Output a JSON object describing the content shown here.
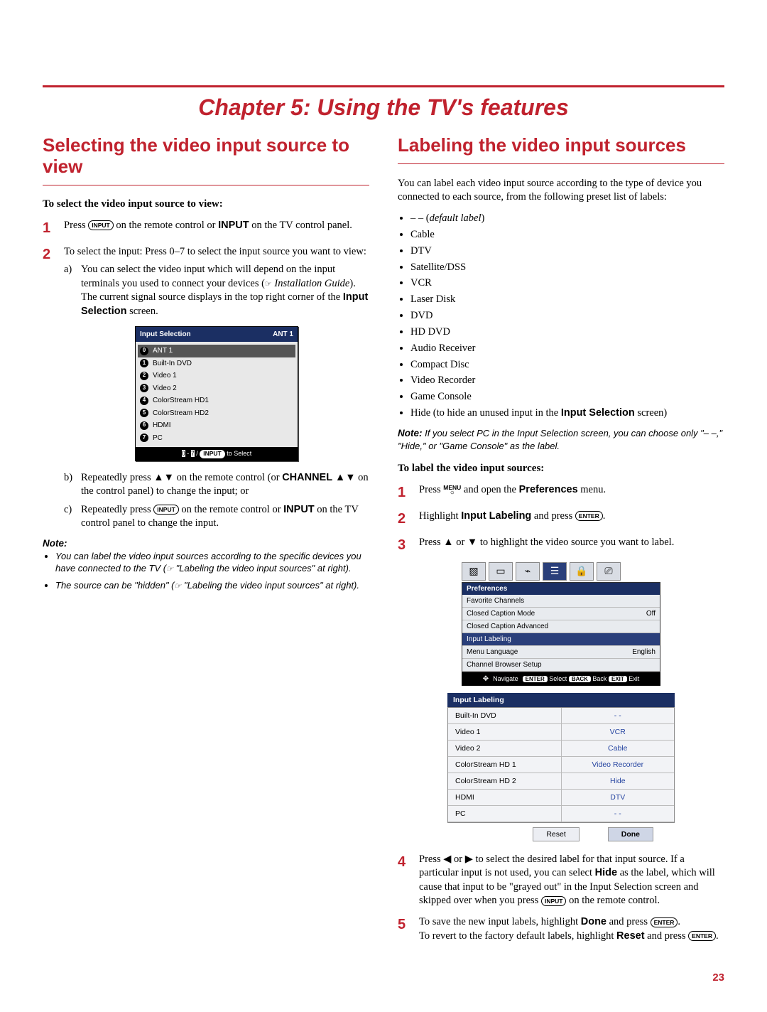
{
  "chapter_title": "Chapter 5: Using the TV's features",
  "page_number": "23",
  "left": {
    "heading": "Selecting the video input source to view",
    "proc_title": "To select the video input source to view:",
    "step1": {
      "prefix": "Press ",
      "key": "INPUT",
      "mid": " on the remote control or ",
      "bold": "INPUT",
      "suffix": " on the TV control panel."
    },
    "step2": {
      "text": "To select the input: Press 0–7 to select the input source you want to view:",
      "a_pre": "You can select the video input which will depend on the input terminals you used to connect your devices (",
      "a_hand": "☞",
      "a_ital": " Installation Guide",
      "a_post": ").",
      "a_line2_pre": "The current signal source displays in the top right corner of the ",
      "a_line2_bold": "Input Selection",
      "a_line2_post": " screen.",
      "b_pre": "Repeatedly press ▲▼ on the remote control (or ",
      "b_bold": "CHANNEL ▲▼",
      "b_post": " on the control panel) to change the input; or",
      "c_pre": "Repeatedly press ",
      "c_key": "INPUT",
      "c_mid": " on the remote control or ",
      "c_bold": "INPUT",
      "c_post": " on the TV control panel to change the input."
    },
    "osd": {
      "title": "Input Selection",
      "badge": "ANT 1",
      "items": [
        {
          "n": "0",
          "label": "ANT 1",
          "hl": true
        },
        {
          "n": "1",
          "label": "Built-In DVD"
        },
        {
          "n": "2",
          "label": "Video 1"
        },
        {
          "n": "3",
          "label": "Video 2"
        },
        {
          "n": "4",
          "label": "ColorStream HD1"
        },
        {
          "n": "5",
          "label": "ColorStream HD2"
        },
        {
          "n": "6",
          "label": "HDMI"
        },
        {
          "n": "7",
          "label": "PC"
        }
      ],
      "footer_a": "0",
      "footer_b": "7",
      "footer_sep": " - ",
      "footer_slash": " / ",
      "footer_pill": "INPUT",
      "footer_tail": " to Select"
    },
    "note_title": "Note:",
    "note_items": [
      {
        "pre": "You can label the video input sources according to the specific devices you have connected to the TV (",
        "hand": "☞",
        "ital": " \"Labeling the video input sources\" at right",
        "post": ")."
      },
      {
        "pre": "The source can be \"hidden\" (",
        "hand": "☞",
        "ital": " \"Labeling the video input sources\" at right",
        "post": ")."
      }
    ]
  },
  "right": {
    "heading": "Labeling the video input sources",
    "intro_pre": "You can label each video input source according to the type of device you connected to each source, from the following preset list of labels:",
    "labels": [
      {
        "text": "– – (",
        "ital": "default label",
        "post": ")"
      },
      {
        "text": "Cable"
      },
      {
        "text": "DTV"
      },
      {
        "text": "Satellite/DSS"
      },
      {
        "text": "VCR"
      },
      {
        "text": "Laser Disk"
      },
      {
        "text": "DVD"
      },
      {
        "text": "HD DVD"
      },
      {
        "text": "Audio Receiver"
      },
      {
        "text": "Compact Disc"
      },
      {
        "text": "Video Recorder"
      },
      {
        "text": "Game Console"
      },
      {
        "pretext": "Hide (to hide an unused input in the ",
        "bold": "Input Selection",
        "post": " screen)"
      }
    ],
    "note_title": "Note:",
    "note_body": " If you select PC in the Input Selection screen, you can choose only \"– –,\" \"Hide,\" or \"Game Console\" as the label.",
    "proc_title": "To label the video input sources:",
    "step1": {
      "pre": "Press ",
      "menu": "MENU",
      "mid": " and open the ",
      "bold": "Preferences",
      "post": " menu."
    },
    "step2": {
      "pre": "Highlight ",
      "bold": "Input Labeling",
      "mid": " and press ",
      "key": "ENTER",
      "post": "."
    },
    "step3": {
      "text": "Press ▲ or ▼ to highlight the video source you want to label."
    },
    "pref": {
      "title": "Preferences",
      "rows": [
        {
          "l": "Favorite Channels",
          "r": ""
        },
        {
          "l": "Closed Caption Mode",
          "r": "Off"
        },
        {
          "l": "Closed Caption Advanced",
          "r": ""
        },
        {
          "l": "Input Labeling",
          "r": "",
          "hl": true
        },
        {
          "l": "Menu Language",
          "r": "English"
        },
        {
          "l": "Channel Browser Setup",
          "r": ""
        }
      ],
      "foot_nav": "Navigate",
      "foot_keys": [
        {
          "k": "ENTER",
          "t": "Select"
        },
        {
          "k": "BACK",
          "t": "Back"
        },
        {
          "k": "EXIT",
          "t": "Exit"
        }
      ]
    },
    "il": {
      "title": "Input Labeling",
      "rows": [
        {
          "l": "Built-In DVD",
          "r": "- -"
        },
        {
          "l": "Video 1",
          "r": "VCR"
        },
        {
          "l": "Video 2",
          "r": "Cable"
        },
        {
          "l": "ColorStream HD 1",
          "r": "Video Recorder"
        },
        {
          "l": "ColorStream HD 2",
          "r": "Hide"
        },
        {
          "l": "HDMI",
          "r": "DTV"
        },
        {
          "l": "PC",
          "r": "- -"
        }
      ],
      "reset": "Reset",
      "done": "Done"
    },
    "step4": {
      "pre": "Press ◀ or ▶ to select the desired label for that input source. If a particular input is not used, you can select ",
      "bold": "Hide",
      "mid": " as the label, which will cause that input to be \"grayed out\" in the Input Selection screen and skipped over when you press ",
      "key": "INPUT",
      "post": " on the remote control."
    },
    "step5": {
      "pre": "To save the new input labels, highlight ",
      "bold1": "Done",
      "mid1": " and press ",
      "key1": "ENTER",
      "post1": ".",
      "line2_pre": "To revert to the factory default labels, highlight ",
      "line2_bold": "Reset",
      "line2_mid": " and press ",
      "line2_key": "ENTER",
      "line2_post": "."
    }
  }
}
